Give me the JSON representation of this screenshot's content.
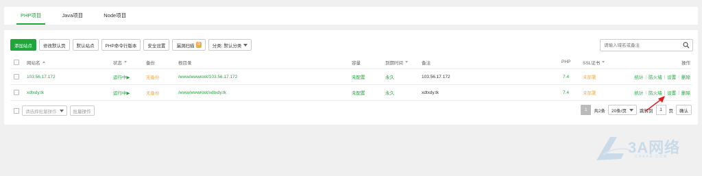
{
  "tabs": [
    {
      "label": "PHP项目",
      "active": true
    },
    {
      "label": "Java项目",
      "active": false
    },
    {
      "label": "Node项目",
      "active": false
    }
  ],
  "toolbar": {
    "add_site": "添加站点",
    "modify_default_page": "修改默认页",
    "default_site": "默认站点",
    "php_cli_version": "PHP命令行版本",
    "security_settings": "安全设置",
    "vuln_scan": "漏洞扫描",
    "vuln_scan_badge": "0",
    "category": "分类: 默认分类"
  },
  "search": {
    "placeholder": "请输入域名或备注"
  },
  "table": {
    "headers": {
      "site_name": "网站名",
      "status": "状态",
      "backup": "备份",
      "root_dir": "根目录",
      "capacity": "容量",
      "expire": "到期时间",
      "remark": "备注",
      "php": "PHP",
      "ssl": "SSL证书",
      "ops": "操作"
    },
    "rows": [
      {
        "site_name": "103.56.17.172",
        "status": "运行中▶",
        "backup": "无备份",
        "root_dir": "/www/wwwroot/103.56.17.172",
        "capacity": "未配置",
        "expire": "永久",
        "remark": "103.56.17.172",
        "php": "7.4",
        "ssl": "未部署",
        "ops": [
          "统计",
          "防火墙",
          "设置",
          "删除"
        ]
      },
      {
        "site_name": "xdtxdy.tk",
        "status": "运行中▶",
        "backup": "无备份",
        "root_dir": "/www/wwwroot/xdtxdy.tk",
        "capacity": "未配置",
        "expire": "永久",
        "remark": "xdtxdy.tk",
        "php": "7.4",
        "ssl": "未部署",
        "ops": [
          "统计",
          "防火墙",
          "设置",
          "删除"
        ]
      }
    ]
  },
  "footer": {
    "batch_select_placeholder": "请选择批量操作",
    "batch_button": "批量操作",
    "current_page": "1",
    "total": "共2条",
    "per_page": "20条/页",
    "jump_to": "跳转到",
    "jump_value": "1",
    "page_unit": "页",
    "confirm": "确认"
  },
  "watermark": {
    "brand": "3A网络",
    "sub": "CNAAA.COM"
  },
  "colors": {
    "accent": "#20a53a",
    "warning": "#f0ad4e",
    "annotation": "#e02020"
  }
}
